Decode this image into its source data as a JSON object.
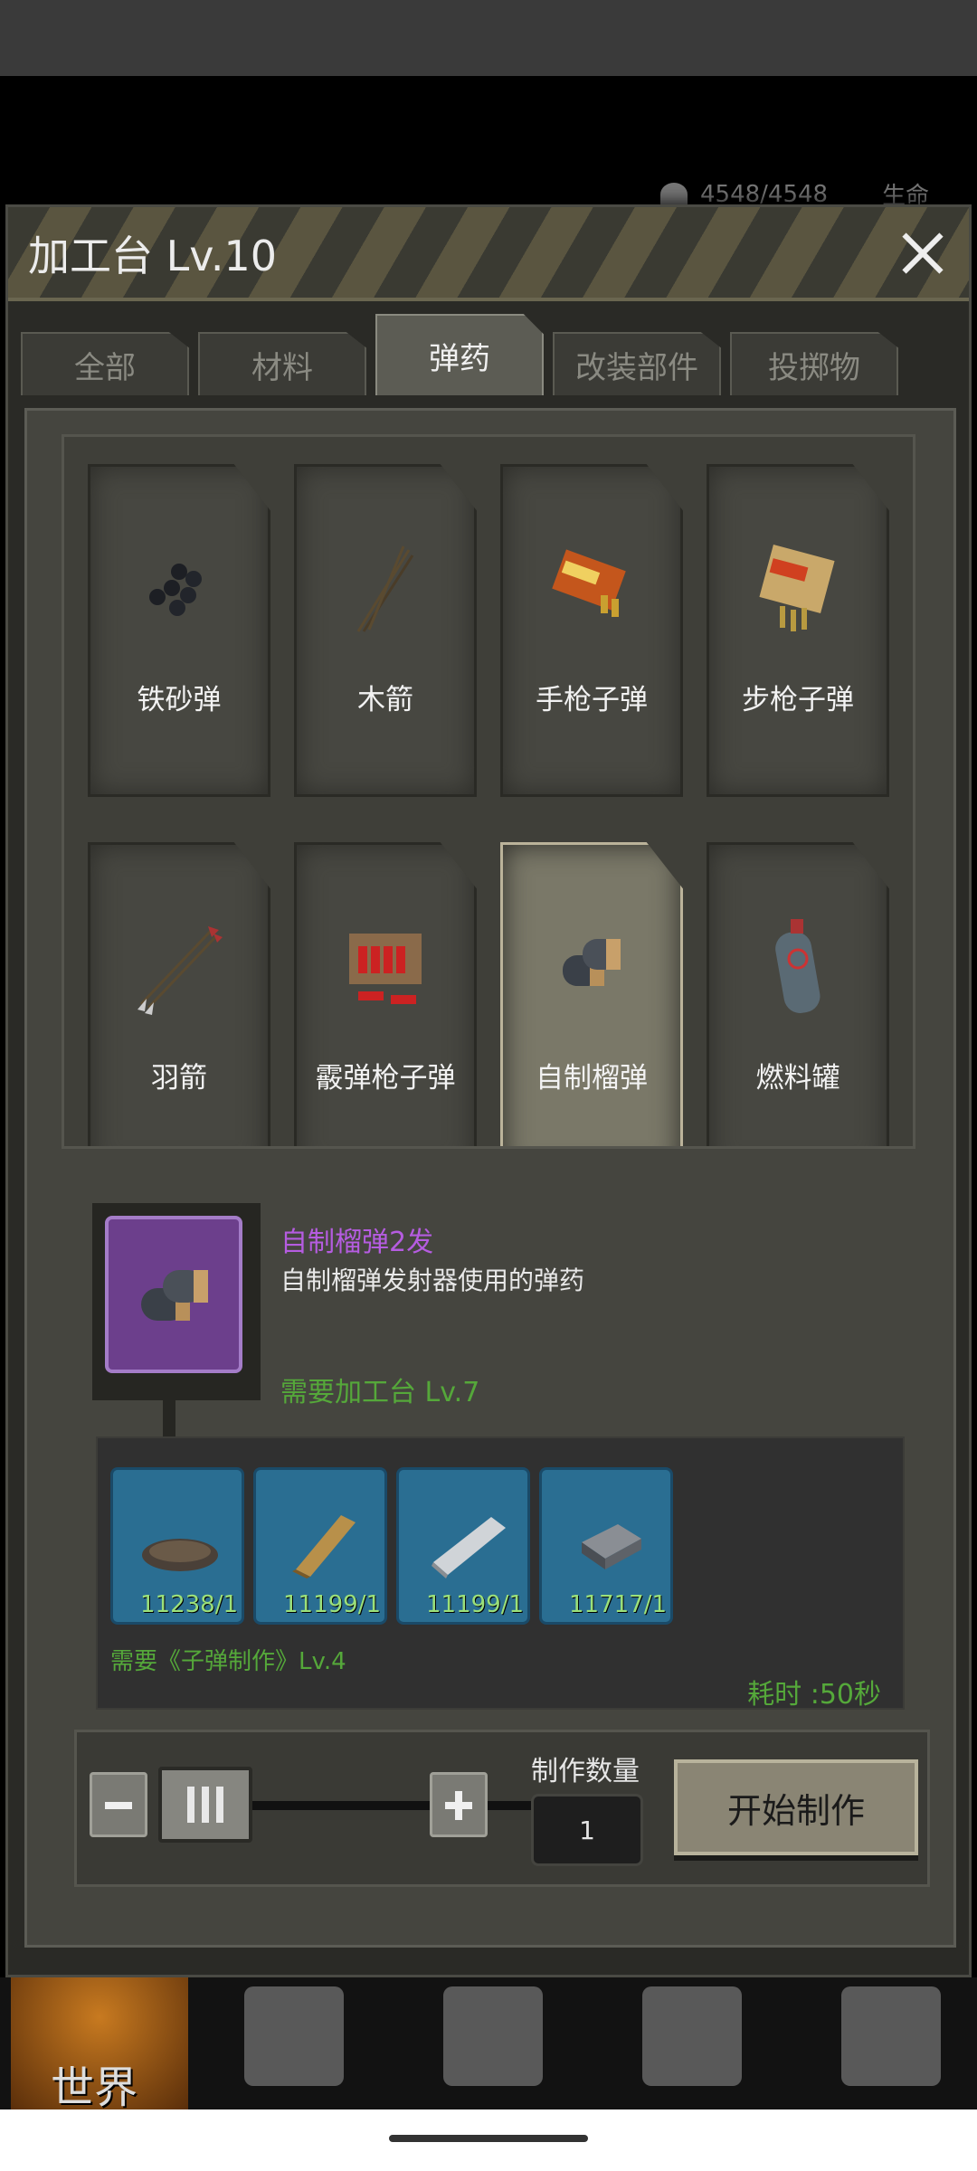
{
  "top_stats": {
    "health": "4548/4548",
    "label": "生命"
  },
  "dialog": {
    "title": "加工台 Lv.10"
  },
  "tabs": [
    {
      "label": "全部"
    },
    {
      "label": "材料"
    },
    {
      "label": "弹药",
      "active": true
    },
    {
      "label": "改装部件"
    },
    {
      "label": "投掷物"
    }
  ],
  "items": [
    {
      "label": "铁砂弹",
      "icon": "iron-shot-icon"
    },
    {
      "label": "木箭",
      "icon": "wooden-arrow-icon"
    },
    {
      "label": "手枪子弹",
      "icon": "pistol-ammo-icon"
    },
    {
      "label": "步枪子弹",
      "icon": "rifle-ammo-icon"
    },
    {
      "label": "羽箭",
      "icon": "feather-arrow-icon"
    },
    {
      "label": "霰弹枪子弹",
      "icon": "shotgun-shell-icon"
    },
    {
      "label": "自制榴弹",
      "icon": "grenade-round-icon",
      "selected": true
    },
    {
      "label": "燃料罐",
      "icon": "fuel-tank-icon"
    }
  ],
  "detail": {
    "name": "自制榴弹2发",
    "description": "自制榴弹发射器使用的弹药",
    "require_bench": "需要加工台 Lv.7",
    "materials": [
      {
        "count": "11238/1",
        "icon": "gravel-icon"
      },
      {
        "count": "11199/1",
        "icon": "wood-plank-icon"
      },
      {
        "count": "11199/1",
        "icon": "metal-bar-icon"
      },
      {
        "count": "11717/1",
        "icon": "iron-ingot-icon"
      }
    ],
    "require_skill": "需要《子弹制作》Lv.4",
    "time": "耗时 :50秒"
  },
  "craft": {
    "quantity_label": "制作数量",
    "quantity": "1",
    "start_label": "开始制作"
  },
  "bottom_nav": {
    "world_label": "世界"
  },
  "colors": {
    "rare_purple": "#b55ce0",
    "requirement_green": "#55a83a",
    "material_blue": "#2a6e92"
  }
}
